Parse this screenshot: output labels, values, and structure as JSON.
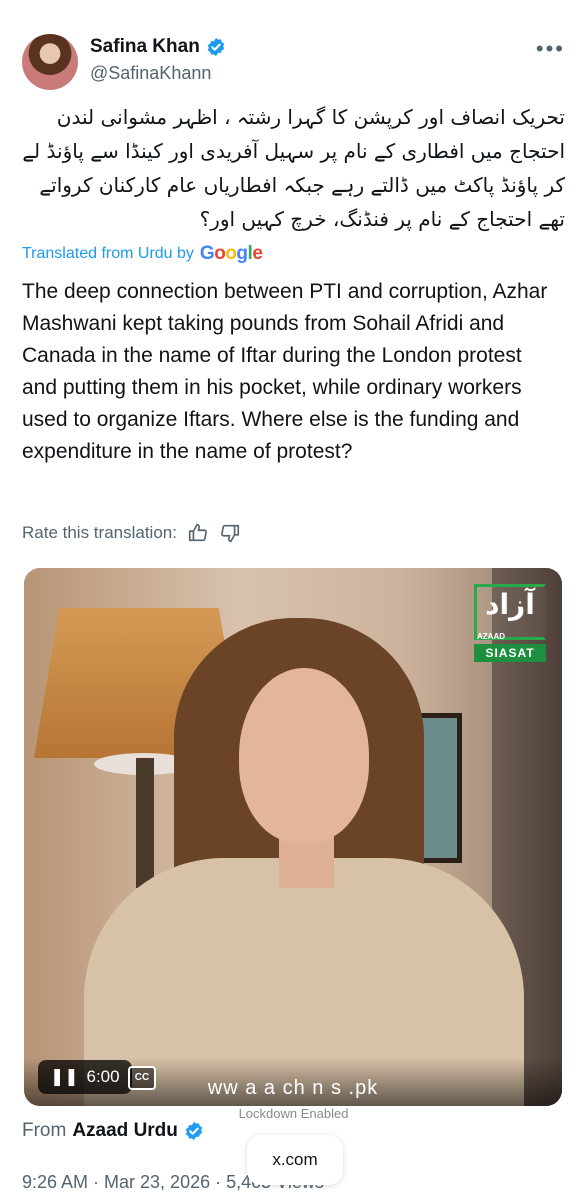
{
  "author": {
    "name": "Safina Khan",
    "handle": "@SafinaKhann",
    "verified_icon": "verified-badge-icon"
  },
  "post": {
    "urdu_text": "تحریک انصاف اور کرپشن کا گہرا رشتہ ، اظہر مشوانی لندن احتجاج میں افطاری کے نام پر سہیل آفریدی اور کینڈا سے پاؤنڈ لے کر پاؤنڈ پاکٹ میں ڈالتے رہے جبکہ افطاریاں عام کارکنان کرواتے تھے احتجاج کے نام پر فنڈنگ، خرچ کہیں اور؟",
    "translated_from": "Translated from Urdu by",
    "translator": "Google",
    "translation": "The deep connection between PTI and corruption, Azhar Mashwani kept taking pounds from Sohail Afridi and Canada in the name of Iftar during the London protest and putting them in his pocket, while ordinary workers used to organize Iftars. Where else is the funding and expenditure in the name of protest?",
    "rate_label": "Rate this translation:"
  },
  "video": {
    "duration": "6:00",
    "cc_label": "CC",
    "watermark_text": "ww   a  a     ch n  s  .pk",
    "logo_word": "آزاد",
    "logo_sub": "AZAAD",
    "logo_siasat": "SIASAT"
  },
  "overlay": {
    "lockdown": "Lockdown Enabled",
    "site": "x.com"
  },
  "source": {
    "from_label": "From",
    "from_name": "Azaad Urdu"
  },
  "footer": {
    "time": "9:26 AM · Mar 23, 2026 · 5,465 Views"
  },
  "colors": {
    "accent": "#1d9bf0",
    "text": "#0f1419",
    "muted": "#536471",
    "logo_green": "#1e8f3f"
  }
}
